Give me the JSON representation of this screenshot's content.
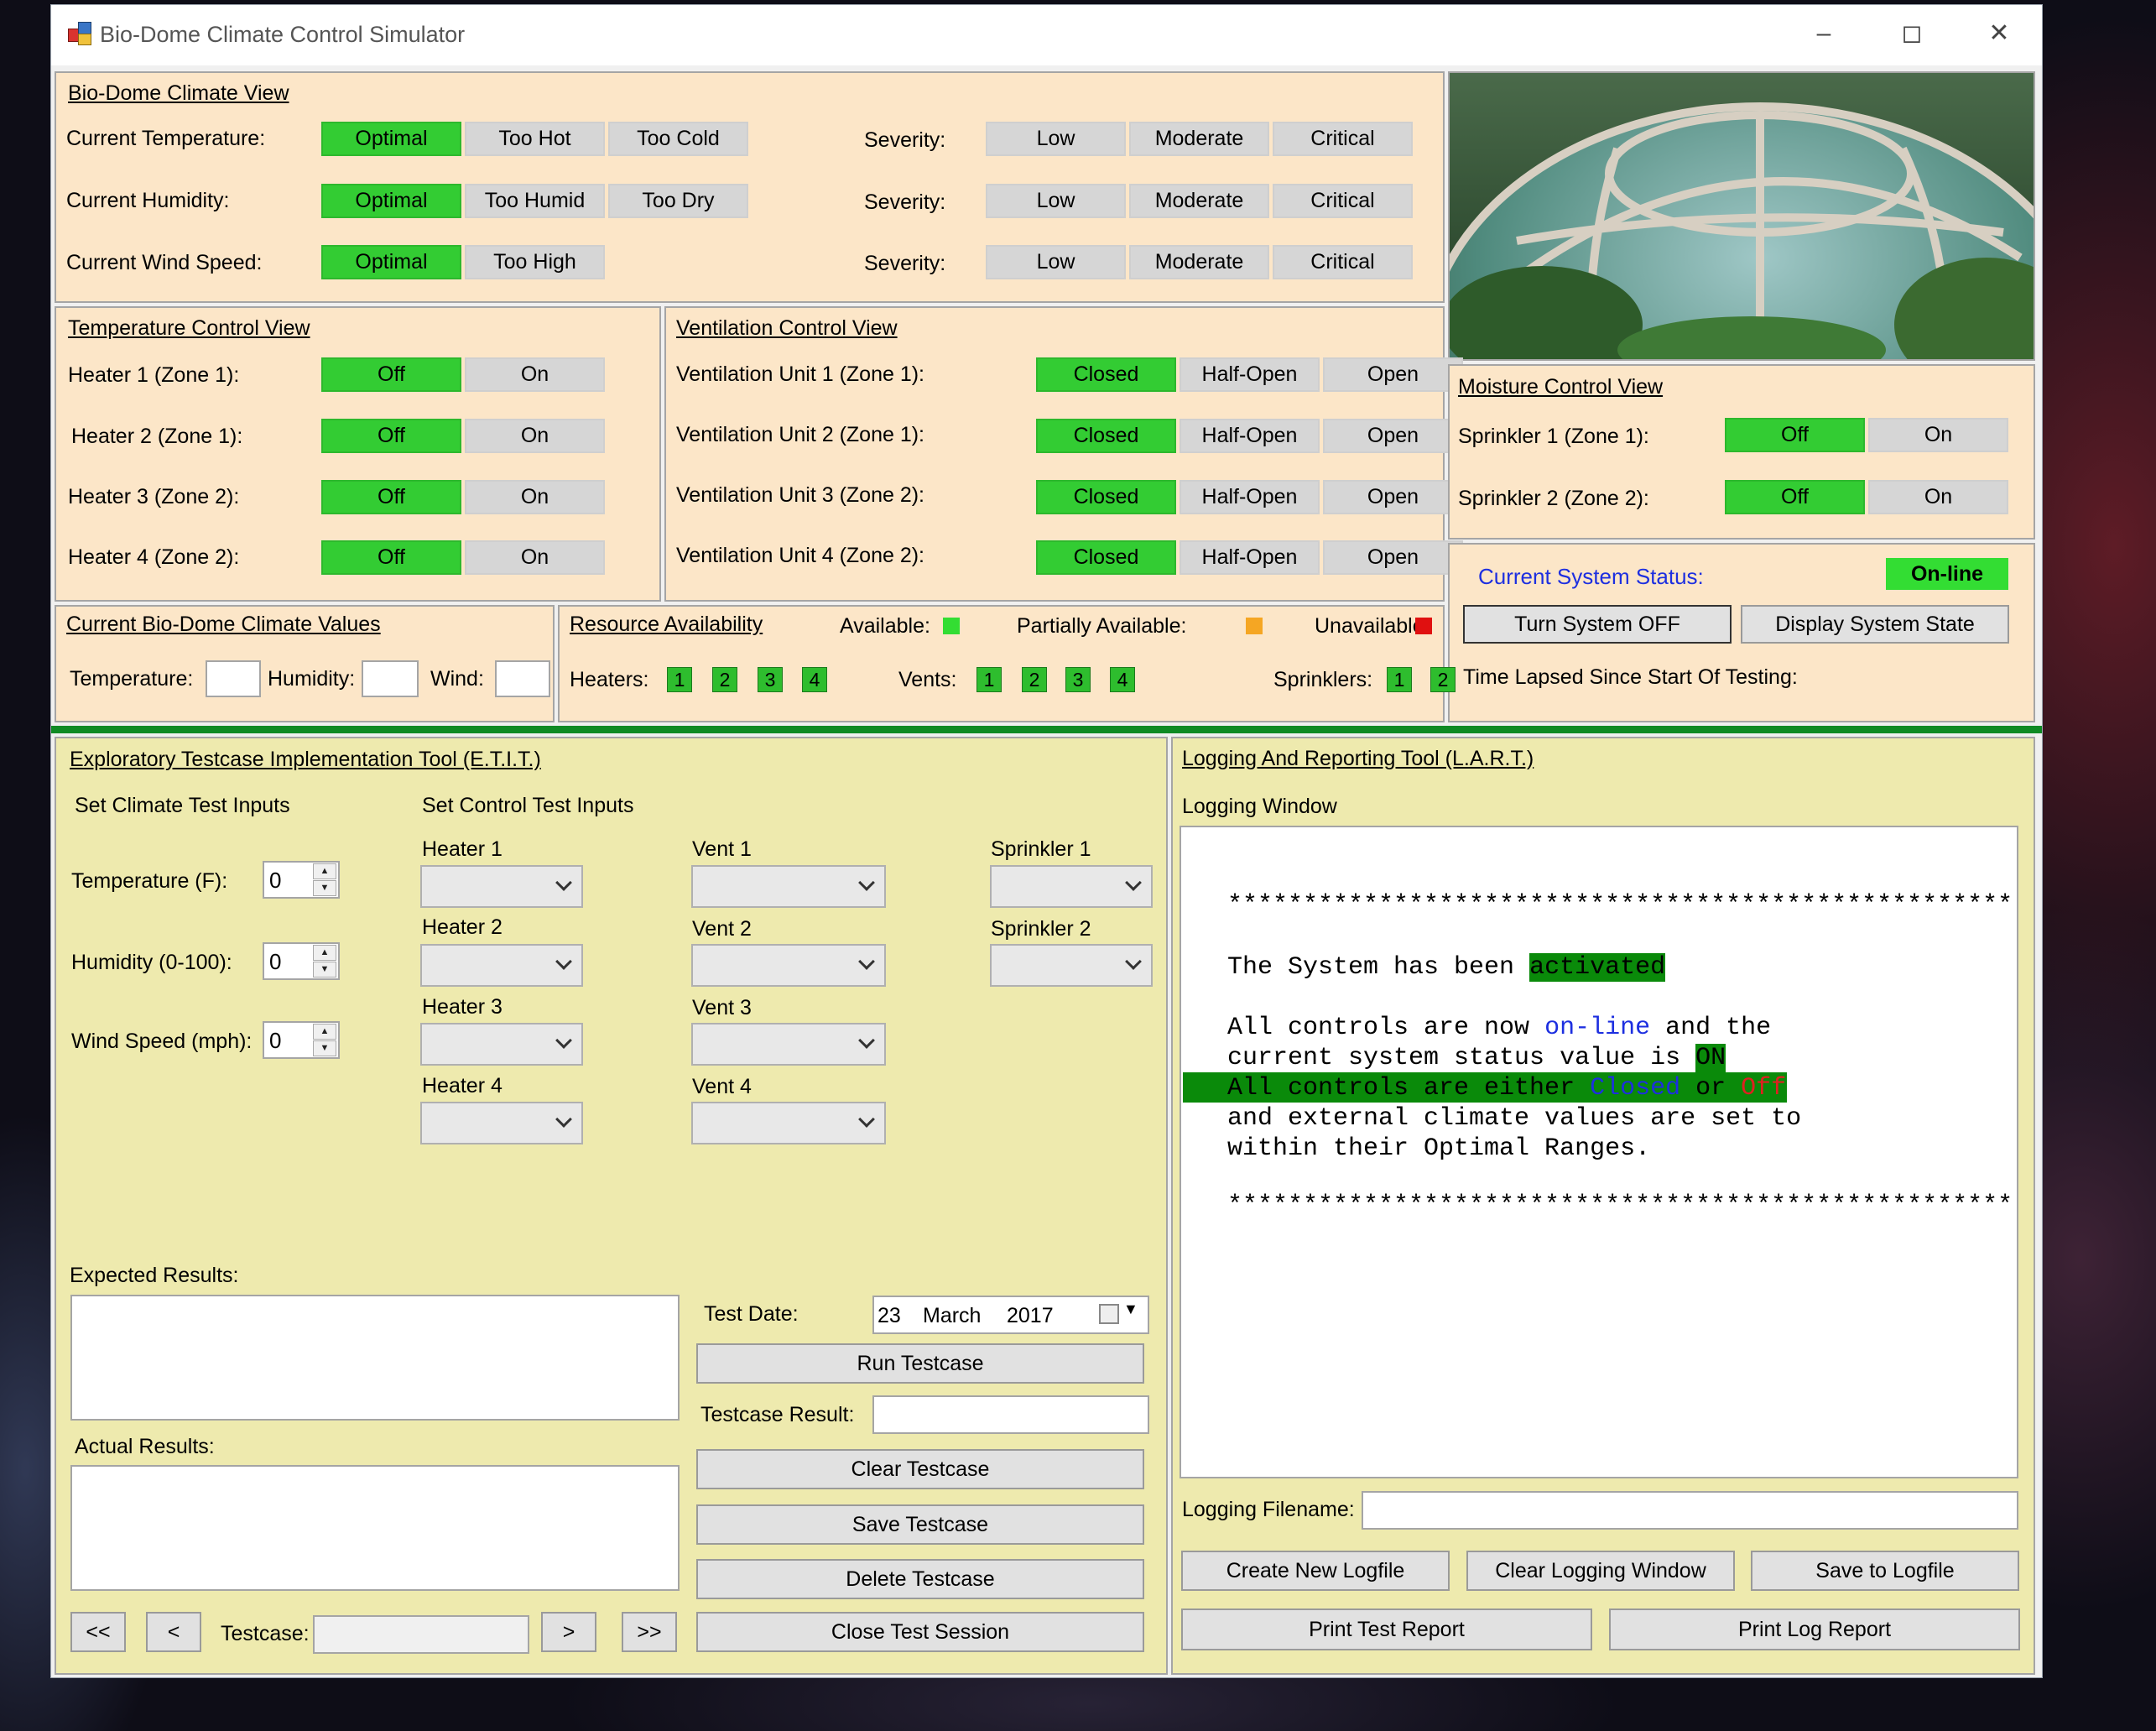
{
  "window": {
    "title": "Bio-Dome Climate Control Simulator"
  },
  "climate_view": {
    "header": "Bio-Dome Climate View",
    "severity_label": "Severity:",
    "rows": [
      {
        "label": "Current Temperature:",
        "opts": [
          "Optimal",
          "Too Hot",
          "Too Cold"
        ],
        "selected": "Optimal"
      },
      {
        "label": "Current Humidity:",
        "opts": [
          "Optimal",
          "Too Humid",
          "Too Dry"
        ],
        "selected": "Optimal"
      },
      {
        "label": "Current Wind Speed:",
        "opts": [
          "Optimal",
          "Too High"
        ],
        "selected": "Optimal"
      }
    ],
    "severity_opts": [
      "Low",
      "Moderate",
      "Critical"
    ]
  },
  "temp_control": {
    "header": "Temperature Control View",
    "rows": [
      {
        "label": "Heater 1 (Zone 1):",
        "off": "Off",
        "on": "On"
      },
      {
        "label": "Heater 2 (Zone 1):",
        "off": "Off",
        "on": "On"
      },
      {
        "label": "Heater 3 (Zone 2):",
        "off": "Off",
        "on": "On"
      },
      {
        "label": "Heater 4 (Zone 2):",
        "off": "Off",
        "on": "On"
      }
    ]
  },
  "vent_control": {
    "header": "Ventilation Control View",
    "rows": [
      {
        "label": "Ventilation Unit 1 (Zone 1):",
        "opts": [
          "Closed",
          "Half-Open",
          "Open"
        ]
      },
      {
        "label": "Ventilation Unit 2 (Zone 1):",
        "opts": [
          "Closed",
          "Half-Open",
          "Open"
        ]
      },
      {
        "label": "Ventilation Unit 3 (Zone 2):",
        "opts": [
          "Closed",
          "Half-Open",
          "Open"
        ]
      },
      {
        "label": "Ventilation Unit 4 (Zone 2):",
        "opts": [
          "Closed",
          "Half-Open",
          "Open"
        ]
      }
    ]
  },
  "moisture_control": {
    "header": "Moisture Control View",
    "rows": [
      {
        "label": "Sprinkler 1 (Zone 1):",
        "off": "Off",
        "on": "On"
      },
      {
        "label": "Sprinkler 2 (Zone 2):",
        "off": "Off",
        "on": "On"
      }
    ]
  },
  "system_status": {
    "label": "Current System Status:",
    "value": "On-line",
    "turn_off": "Turn System OFF",
    "display_state": "Display System State",
    "time_lapsed": "Time Lapsed Since Start Of Testing:"
  },
  "climate_values": {
    "header": "Current Bio-Dome Climate Values",
    "temperature": "Temperature:",
    "humidity": "Humidity:",
    "wind": "Wind:"
  },
  "resources": {
    "header": "Resource Availability",
    "available": "Available:",
    "partial": "Partially Available:",
    "unavailable": "Unavailable:",
    "heaters_label": "Heaters:",
    "heaters": [
      "1",
      "2",
      "3",
      "4"
    ],
    "vents_label": "Vents:",
    "vents": [
      "1",
      "2",
      "3",
      "4"
    ],
    "sprinklers_label": "Sprinklers:",
    "sprinklers": [
      "1",
      "2"
    ],
    "colors": {
      "available": "#33dd33",
      "partial": "#f5a623",
      "unavailable": "#e01010"
    }
  },
  "etit": {
    "header": "Exploratory Testcase Implementation Tool (E.T.I.T.)",
    "climate_inputs": "Set Climate Test Inputs",
    "control_inputs": "Set Control Test Inputs",
    "temperature_label": "Temperature (F):",
    "temperature_value": "0",
    "humidity_label": "Humidity (0-100):",
    "humidity_value": "0",
    "wind_label": "Wind Speed (mph):",
    "wind_value": "0",
    "heaters": [
      "Heater 1",
      "Heater 2",
      "Heater 3",
      "Heater 4"
    ],
    "vents": [
      "Vent 1",
      "Vent 2",
      "Vent 3",
      "Vent 4"
    ],
    "sprinklers": [
      "Sprinkler 1",
      "Sprinkler 2"
    ],
    "expected_results": "Expected Results:",
    "actual_results": "Actual Results:",
    "test_date_label": "Test Date:",
    "test_date": {
      "day": "23",
      "month": "March",
      "year": "2017"
    },
    "run": "Run Testcase",
    "result_label": "Testcase Result:",
    "clear": "Clear Testcase",
    "save": "Save Testcase",
    "delete": "Delete Testcase",
    "close": "Close Test Session",
    "nav_first": "<<",
    "nav_prev": "<",
    "testcase_label": "Testcase:",
    "nav_next": ">",
    "nav_last": ">>"
  },
  "lart": {
    "header": "Logging And Reporting Tool (L.A.R.T.)",
    "window_label": "Logging Window",
    "log": {
      "stars": "****************************************************",
      "l1a": "The System has been ",
      "l1b": "activated",
      "l2a": "All controls are now ",
      "l2b": "on-line",
      "l2c": " and the",
      "l3a": "current system status value is ",
      "l3b": "ON",
      "l4a": "All controls are either ",
      "l4b": "Closed",
      "l4c": " or ",
      "l4d": "Off",
      "l5": "and external climate values are set to",
      "l6": "within their Optimal Ranges."
    },
    "filename_label": "Logging Filename:",
    "create": "Create New Logfile",
    "clear": "Clear Logging Window",
    "save": "Save to Logfile",
    "print_test": "Print Test Report",
    "print_log": "Print Log Report"
  }
}
